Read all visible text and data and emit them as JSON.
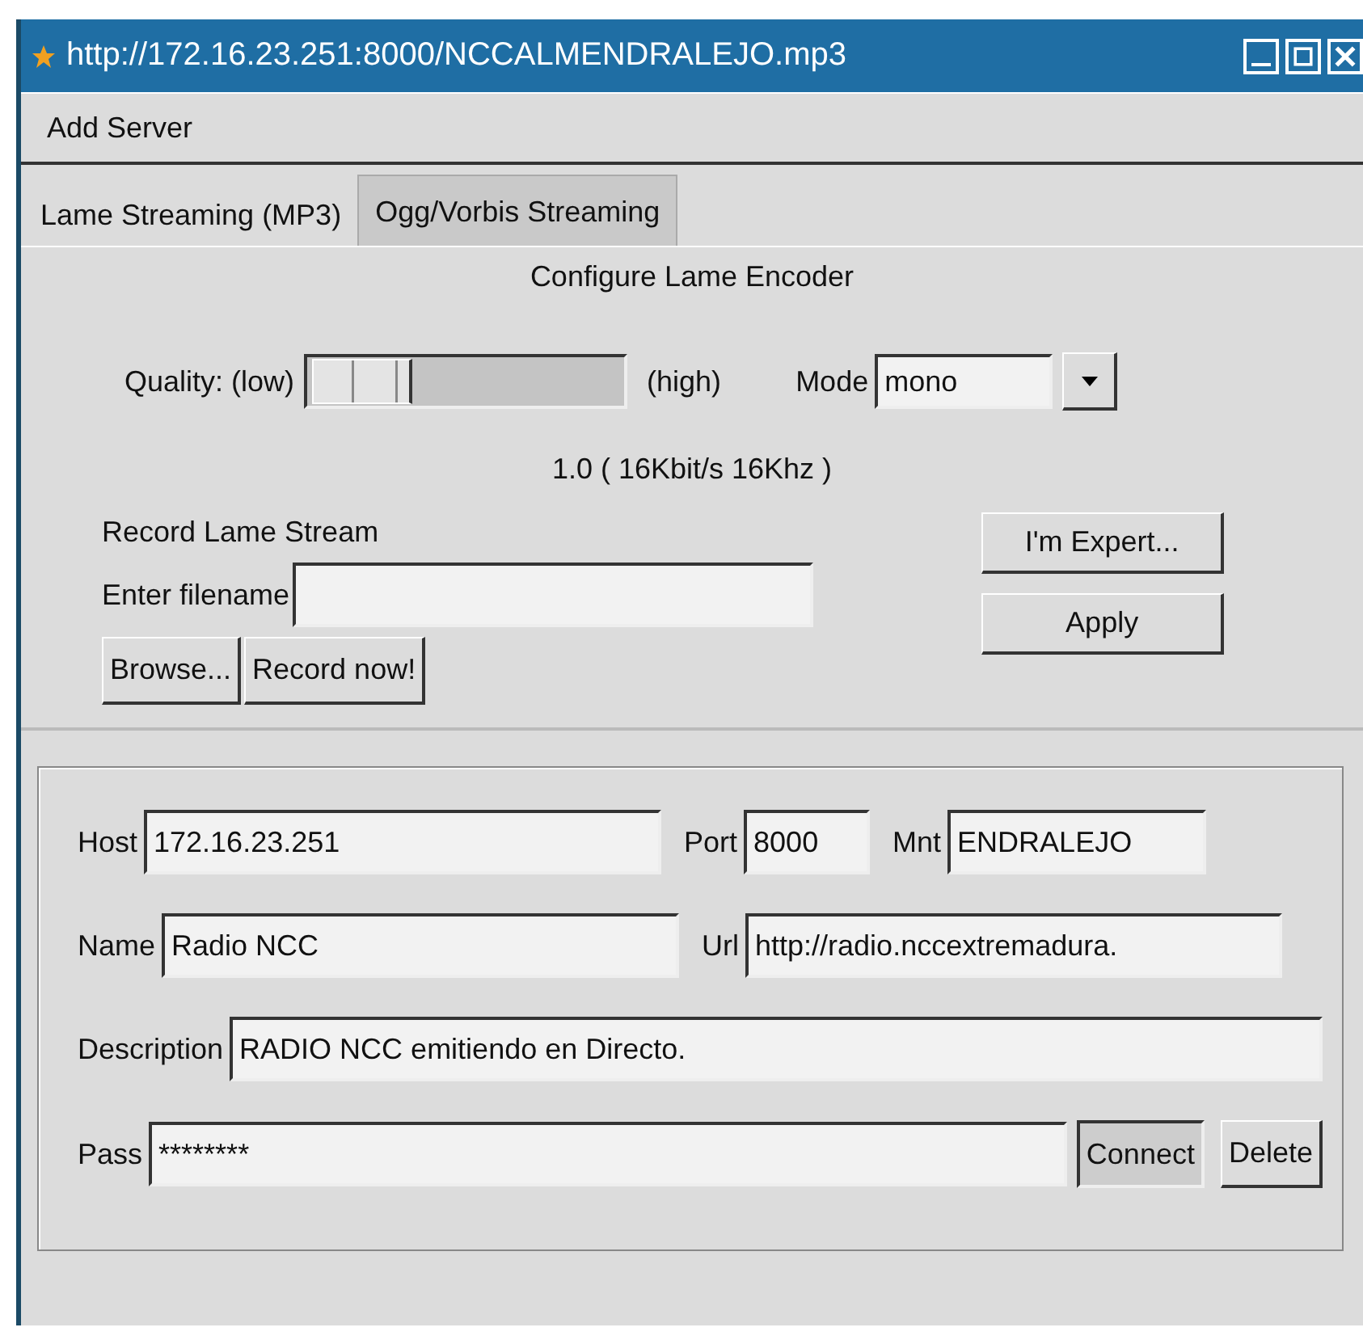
{
  "window": {
    "title": "http://172.16.23.251:8000/NCCALMENDRALEJO.mp3"
  },
  "menu": [
    {
      "label": "Add Server"
    }
  ],
  "tabs": [
    {
      "label": "Lame Streaming (MP3)",
      "selected": true
    },
    {
      "label": "Ogg/Vorbis Streaming",
      "selected": false
    }
  ],
  "encoder": {
    "heading": "Configure Lame Encoder",
    "quality_label": "Quality: (low)",
    "quality": {
      "level": 0.02
    },
    "high_label": "(high)",
    "mode_label": "Mode",
    "mode_value": "mono",
    "reading": "1.0 ( 16Kbit/s 16Khz )"
  },
  "record": {
    "heading": "Record Lame Stream",
    "filename_label": "Enter filename",
    "buttons": [
      {
        "label": "Browse..."
      },
      {
        "label": "Record now!"
      }
    ]
  },
  "side_buttons": [
    {
      "label": "I'm Expert..."
    },
    {
      "label": "Apply"
    }
  ],
  "server": {
    "rows": [
      [
        {
          "label": "Host",
          "value": "172.16.23.251"
        },
        {
          "label": "Port",
          "value": "8000"
        },
        {
          "label": "Mnt",
          "value": "ENDRALEJO"
        }
      ],
      [
        {
          "label": "Name",
          "value": "Radio NCC"
        },
        {
          "label": "Url",
          "value": "http://radio.nccextremadura."
        }
      ],
      [
        {
          "label": "Description",
          "value": "RADIO NCC emitiendo en Directo."
        }
      ],
      [
        {
          "label": "Pass",
          "value": "********"
        }
      ]
    ],
    "buttons": [
      {
        "label": "Connect",
        "pressed": true
      },
      {
        "label": "Delete",
        "pressed": false
      }
    ]
  }
}
